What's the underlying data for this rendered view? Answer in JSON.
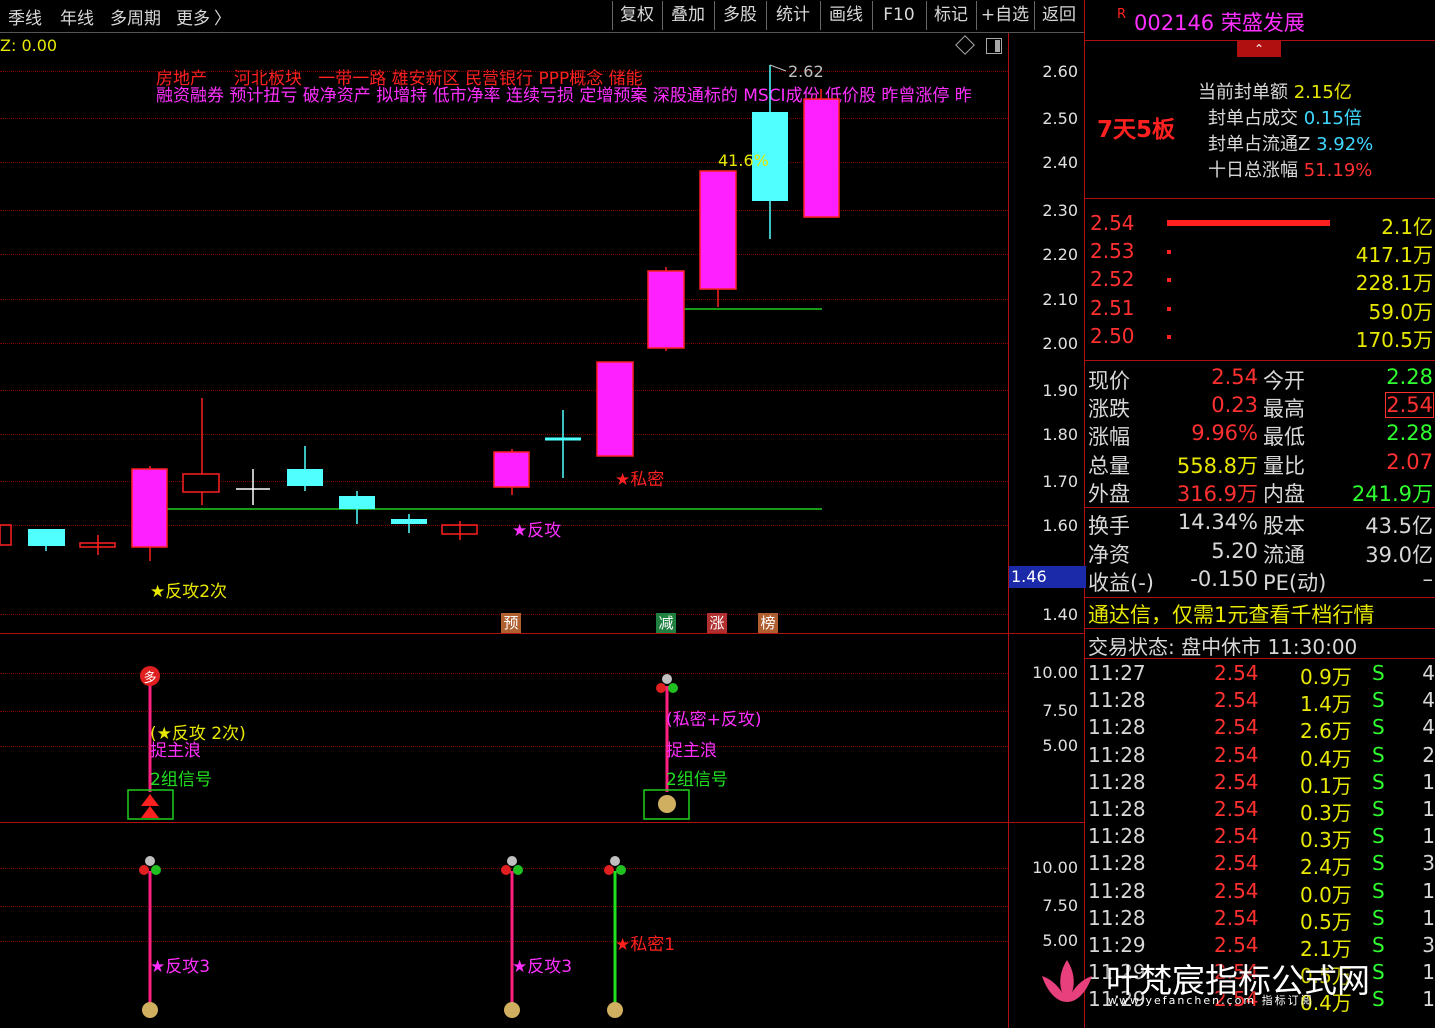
{
  "toolbar": {
    "left_items": [
      "季线",
      "年线",
      "多周期",
      "更多"
    ],
    "more_chevron": "〉",
    "right_buttons": [
      "复权",
      "叠加",
      "多股",
      "统计",
      "画线",
      "F10",
      "标记",
      "+自选",
      "返回"
    ]
  },
  "main_chart": {
    "z_readout": "Z: 0.00",
    "concept_line1": [
      "房地产",
      "河北板块",
      "一带一路",
      "雄安新区",
      "民营银行",
      "PPP概念",
      "储能"
    ],
    "concept_line2": "融资融券 预计扭亏 破净资产 拟增持 低市净率 连续亏损 定增预案 深股通标的 MSCI成份 低价股 昨曾涨停 昨",
    "high_marker": "2.62",
    "pct_label": "41.6%",
    "price_ticks": [
      "2.60",
      "2.50",
      "2.40",
      "2.30",
      "2.20",
      "2.10",
      "2.00",
      "1.90",
      "1.80",
      "1.70",
      "1.60",
      "1.40"
    ],
    "cursor_value": "1.46",
    "annotations": {
      "fangong2": "★反攻2次",
      "fangong": "★反攻",
      "simi": "★私密"
    },
    "badges": [
      {
        "text": "预",
        "color": "#b06030"
      },
      {
        "text": "减",
        "color": "#208040"
      },
      {
        "text": "涨",
        "color": "#b03030"
      },
      {
        "text": "榜",
        "color": "#b06030"
      }
    ]
  },
  "panel2": {
    "ticks": [
      "10.00",
      "7.50",
      "5.00"
    ],
    "signal_a": {
      "line1": "(★反攻 2次)",
      "line2": "捉主浪",
      "line3": "2组信号",
      "top_icon": "多"
    },
    "signal_b": {
      "line1": "(私密+反攻)",
      "line2": "捉主浪",
      "line3": "2组信号"
    }
  },
  "panel3": {
    "ticks": [
      "10.00",
      "7.50",
      "5.00"
    ],
    "labels": [
      "★反攻3",
      "★反攻3",
      "★私密1"
    ]
  },
  "stock": {
    "r_mark": "R",
    "code": "002146",
    "name": "荣盛发展",
    "streak": "7天5板",
    "seal_stats": [
      {
        "label": "当前封单额",
        "value": "2.15亿",
        "color": "#e8e800"
      },
      {
        "label": "封单占成交",
        "value": "0.15倍",
        "color": "#40d8ff"
      },
      {
        "label": "封单占流通Z",
        "value": "3.92%",
        "color": "#40d8ff"
      },
      {
        "label": "十日总涨幅",
        "value": "51.19%",
        "color": "#ff3030"
      }
    ]
  },
  "order_book": [
    {
      "price": "2.54",
      "vol": "2.1亿"
    },
    {
      "price": "2.53",
      "vol": "417.1万"
    },
    {
      "price": "2.52",
      "vol": "228.1万"
    },
    {
      "price": "2.51",
      "vol": "59.0万"
    },
    {
      "price": "2.50",
      "vol": "170.5万"
    }
  ],
  "quote": [
    {
      "l1": "现价",
      "v1": "2.54",
      "c1": "#ff3030",
      "l2": "今开",
      "v2": "2.28",
      "c2": "#30ff30"
    },
    {
      "l1": "涨跌",
      "v1": "0.23",
      "c1": "#ff3030",
      "l2": "最高",
      "v2": "2.54",
      "c2": "#ff3030"
    },
    {
      "l1": "涨幅",
      "v1": "9.96%",
      "c1": "#ff3030",
      "l2": "最低",
      "v2": "2.28",
      "c2": "#30ff30"
    },
    {
      "l1": "总量",
      "v1": "558.8万",
      "c1": "#e8e800",
      "l2": "量比",
      "v2": "2.07",
      "c2": "#ff3030"
    },
    {
      "l1": "外盘",
      "v1": "316.9万",
      "c1": "#ff3030",
      "l2": "内盘",
      "v2": "241.9万",
      "c2": "#30ff30"
    }
  ],
  "quote2": [
    {
      "l1": "换手",
      "v1": "14.34%",
      "l2": "股本",
      "v2": "43.5亿"
    },
    {
      "l1": "净资",
      "v1": "5.20",
      "l2": "流通",
      "v2": "39.0亿"
    },
    {
      "l1": "收益(-)",
      "v1": "-0.150",
      "l2": "PE(动)",
      "v2": "–"
    }
  ],
  "promo": "通达信，仅需1元查看千档行情",
  "trade_status": "交易状态: 盘中休市 11:30:00",
  "ticks_list": [
    {
      "t": "11:27",
      "p": "2.54",
      "v": "0.9万",
      "s": "S",
      "n": "4"
    },
    {
      "t": "11:28",
      "p": "2.54",
      "v": "1.4万",
      "s": "S",
      "n": "4"
    },
    {
      "t": "11:28",
      "p": "2.54",
      "v": "2.6万",
      "s": "S",
      "n": "4"
    },
    {
      "t": "11:28",
      "p": "2.54",
      "v": "0.4万",
      "s": "S",
      "n": "2"
    },
    {
      "t": "11:28",
      "p": "2.54",
      "v": "0.1万",
      "s": "S",
      "n": "1"
    },
    {
      "t": "11:28",
      "p": "2.54",
      "v": "0.3万",
      "s": "S",
      "n": "1"
    },
    {
      "t": "11:28",
      "p": "2.54",
      "v": "0.3万",
      "s": "S",
      "n": "1"
    },
    {
      "t": "11:28",
      "p": "2.54",
      "v": "2.4万",
      "s": "S",
      "n": "3"
    },
    {
      "t": "11:28",
      "p": "2.54",
      "v": "0.0万",
      "s": "S",
      "n": "1"
    },
    {
      "t": "11:28",
      "p": "2.54",
      "v": "0.5万",
      "s": "S",
      "n": "1"
    },
    {
      "t": "11:29",
      "p": "2.54",
      "v": "2.1万",
      "s": "S",
      "n": "3"
    },
    {
      "t": "11:29",
      "p": "2.54",
      "v": "0.5万",
      "s": "S",
      "n": "1"
    },
    {
      "t": "11:29",
      "p": "2.54",
      "v": "0.4万",
      "s": "S",
      "n": "1"
    }
  ],
  "watermark": {
    "main": "叶梵宸指标公式网",
    "sub": "www.yefanchen.com 指标订阅"
  }
}
